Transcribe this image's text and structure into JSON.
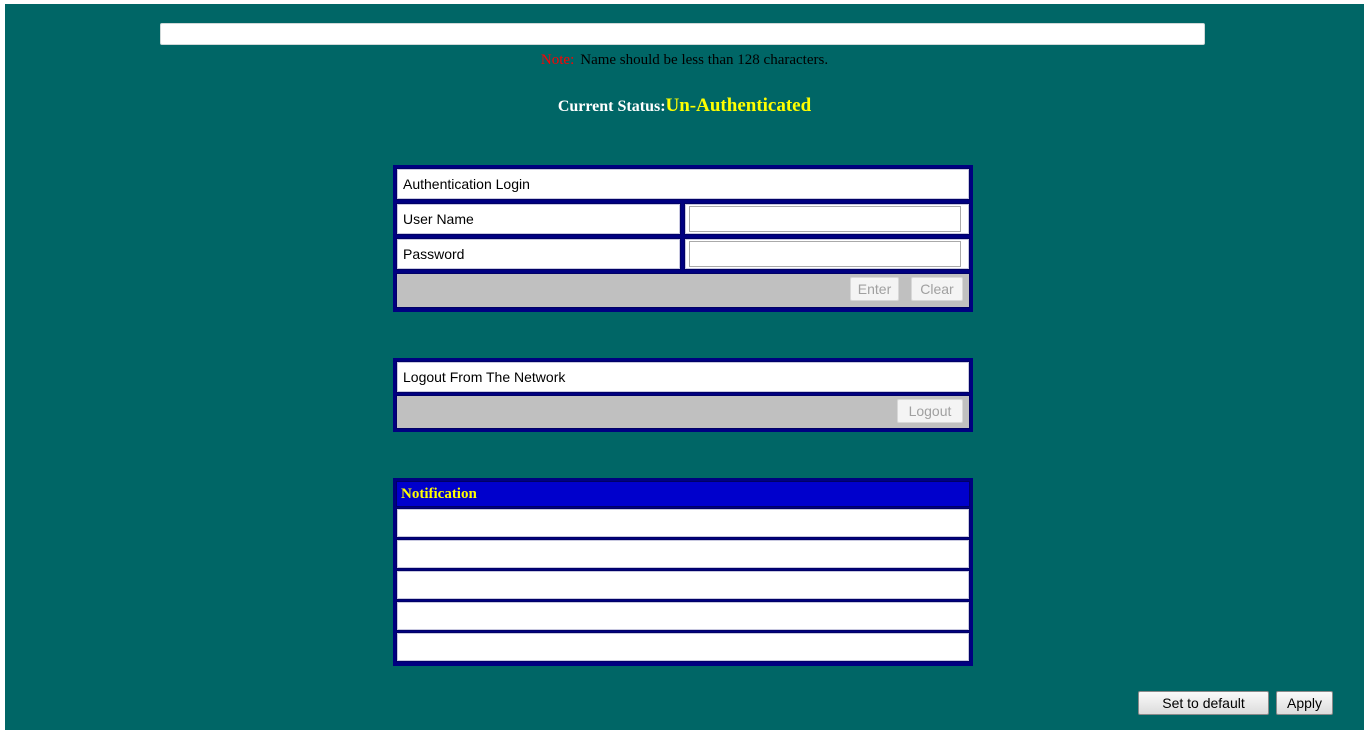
{
  "name_input": {
    "value": ""
  },
  "note": {
    "label": "Note:",
    "text": "Name should be less than 128 characters."
  },
  "status": {
    "label": "Current Status:",
    "value": "Un-Authenticated"
  },
  "login_panel": {
    "title": "Authentication Login",
    "username_label": "User Name",
    "username_value": "",
    "password_label": "Password",
    "password_value": "",
    "enter_label": "Enter",
    "clear_label": "Clear"
  },
  "logout_panel": {
    "title": "Logout From The Network",
    "logout_label": "Logout"
  },
  "notification": {
    "title": "Notification",
    "rows": [
      "",
      "",
      "",
      "",
      ""
    ]
  },
  "footer": {
    "set_default_label": "Set to default",
    "apply_label": "Apply"
  },
  "colors": {
    "background": "#006666",
    "panel_border": "#000080",
    "notification_header": "#0000cc",
    "status_value": "#ffff00",
    "note_label": "#ff0000"
  }
}
